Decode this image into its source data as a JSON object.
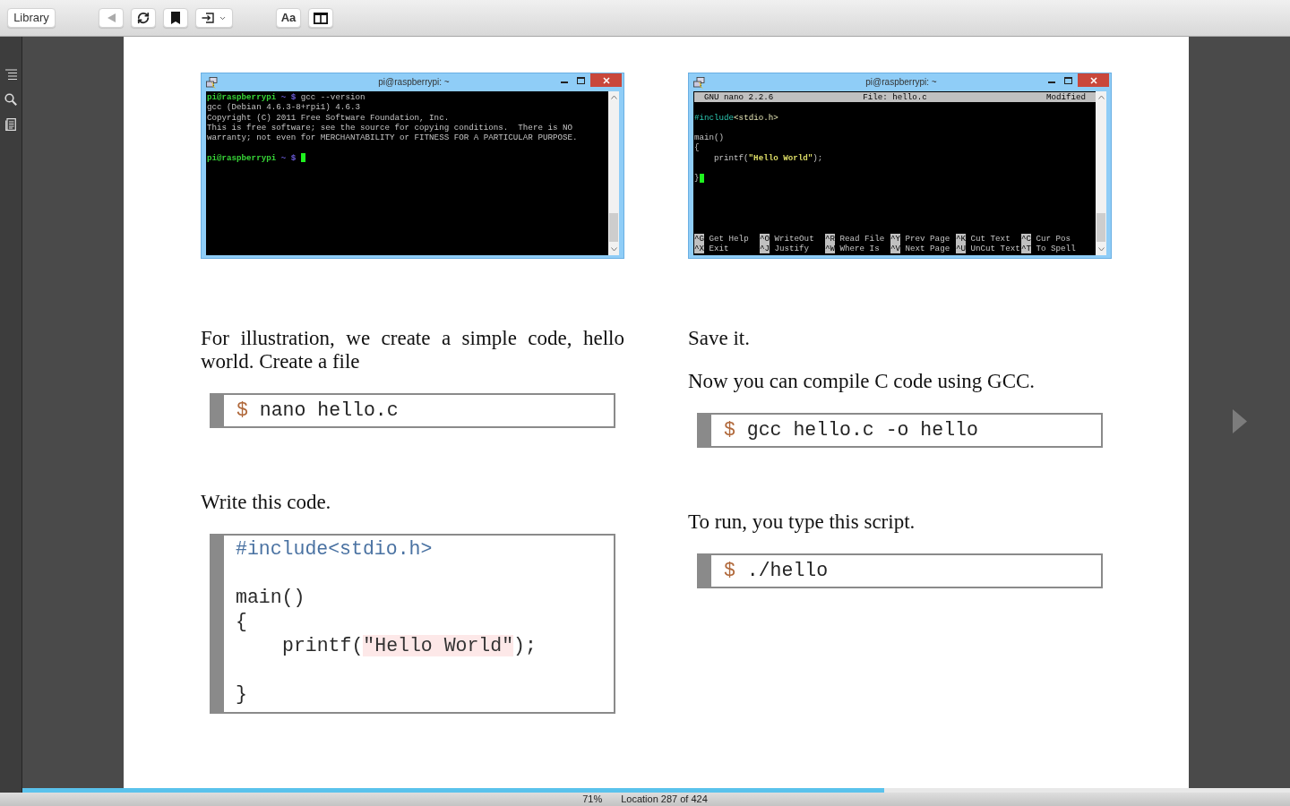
{
  "toolbar": {
    "library": "Library",
    "back": {
      "disabled": true
    },
    "font": "Aa"
  },
  "page": {
    "columns": [
      {
        "blocks": [
          {
            "kind": "shell_terminal",
            "title": "pi@raspberrypi: ~",
            "lines": [
              {
                "kind": "prompt",
                "user": "pi@raspberrypi",
                "path": "~",
                "symbol": "$",
                "command": "gcc --version",
                "cursor": false
              },
              {
                "kind": "output",
                "text": "gcc (Debian 4.6.3-8+rpi1) 4.6.3",
                "cursor": false
              },
              {
                "kind": "output",
                "text": "Copyright (C) 2011 Free Software Foundation, Inc.",
                "cursor": false
              },
              {
                "kind": "output",
                "text": "This is free software; see the source for copying conditions.  There is NO",
                "cursor": false
              },
              {
                "kind": "output",
                "text": "warranty; not even for MERCHANTABILITY or FITNESS FOR A PARTICULAR PURPOSE.",
                "cursor": false
              },
              {
                "kind": "blank"
              },
              {
                "kind": "prompt",
                "user": "pi@raspberrypi",
                "path": "~",
                "symbol": "$",
                "cursor": true
              }
            ]
          },
          {
            "kind": "paragraph",
            "text": "For illustration, we create a simple code, hello world. Create a file"
          },
          {
            "kind": "command",
            "prompt": "$",
            "command": "nano hello.c"
          },
          {
            "kind": "paragraph",
            "text": "Write this code."
          },
          {
            "kind": "code_block",
            "lines": [
              {
                "kind": "text",
                "segments": [
                  {
                    "kind": "directive",
                    "text": "#include<stdio.h>"
                  }
                ]
              },
              {
                "kind": "blank"
              },
              {
                "kind": "text",
                "segments": [
                  {
                    "kind": "plain",
                    "text": "main()"
                  }
                ]
              },
              {
                "kind": "text",
                "segments": [
                  {
                    "kind": "plain",
                    "text": "{"
                  }
                ],
                "children": [
                  {
                    "kind": "text",
                    "segments": [
                      {
                        "kind": "plain",
                        "text": "printf("
                      },
                      {
                        "kind": "string",
                        "text": "\"Hello World\""
                      },
                      {
                        "kind": "plain",
                        "text": ");"
                      }
                    ]
                  },
                  {
                    "kind": "blank"
                  }
                ]
              },
              {
                "kind": "text",
                "segments": [
                  {
                    "kind": "plain",
                    "text": "}"
                  }
                ]
              }
            ]
          }
        ]
      },
      {
        "blocks": [
          {
            "kind": "nano_terminal",
            "title": "pi@raspberrypi: ~",
            "header": {
              "program": "GNU nano 2.2.6",
              "file": "File: hello.c",
              "status": "Modified"
            },
            "lines": [
              {
                "kind": "blank"
              },
              {
                "kind": "text",
                "segments": [
                  {
                    "kind": "directive",
                    "text": "#include"
                  },
                  {
                    "kind": "header",
                    "text": "<stdio.h>"
                  }
                ],
                "cursor": false
              },
              {
                "kind": "blank"
              },
              {
                "kind": "text",
                "segments": [
                  {
                    "kind": "plain",
                    "text": "main()"
                  }
                ],
                "cursor": false
              },
              {
                "kind": "text",
                "segments": [
                  {
                    "kind": "plain",
                    "text": "{"
                  }
                ],
                "cursor": false,
                "children": [
                  {
                    "kind": "text",
                    "segments": [
                      {
                        "kind": "plain",
                        "text": "printf("
                      },
                      {
                        "kind": "string",
                        "text": "\"Hello World\""
                      },
                      {
                        "kind": "plain",
                        "text": ");"
                      }
                    ],
                    "cursor": false
                  },
                  {
                    "kind": "blank"
                  }
                ]
              },
              {
                "kind": "text",
                "segments": [
                  {
                    "kind": "plain",
                    "text": "}"
                  }
                ],
                "cursor": true
              }
            ],
            "shortcut_rows": [
              {
                "items": [
                  {
                    "key": "^G",
                    "label": "Get Help"
                  },
                  {
                    "key": "^O",
                    "label": "WriteOut"
                  },
                  {
                    "key": "^R",
                    "label": "Read File"
                  },
                  {
                    "key": "^Y",
                    "label": "Prev Page"
                  },
                  {
                    "key": "^K",
                    "label": "Cut Text"
                  },
                  {
                    "key": "^C",
                    "label": "Cur Pos"
                  }
                ]
              },
              {
                "items": [
                  {
                    "key": "^X",
                    "label": "Exit"
                  },
                  {
                    "key": "^J",
                    "label": "Justify"
                  },
                  {
                    "key": "^W",
                    "label": "Where Is"
                  },
                  {
                    "key": "^V",
                    "label": "Next Page"
                  },
                  {
                    "key": "^U",
                    "label": "UnCut Text"
                  },
                  {
                    "key": "^T",
                    "label": "To Spell"
                  }
                ]
              }
            ]
          },
          {
            "kind": "paragraph",
            "text": "Save it."
          },
          {
            "kind": "paragraph",
            "text": "Now you can compile C code using GCC."
          },
          {
            "kind": "command",
            "prompt": "$",
            "command": "gcc hello.c -o hello"
          },
          {
            "kind": "paragraph",
            "text": "To run, you type this script."
          },
          {
            "kind": "command",
            "prompt": "$",
            "command": "./hello"
          }
        ]
      }
    ]
  },
  "progress": {
    "level": 0.68
  },
  "status_bar": {
    "percent": "71%",
    "location": "Location 287 of 424"
  }
}
